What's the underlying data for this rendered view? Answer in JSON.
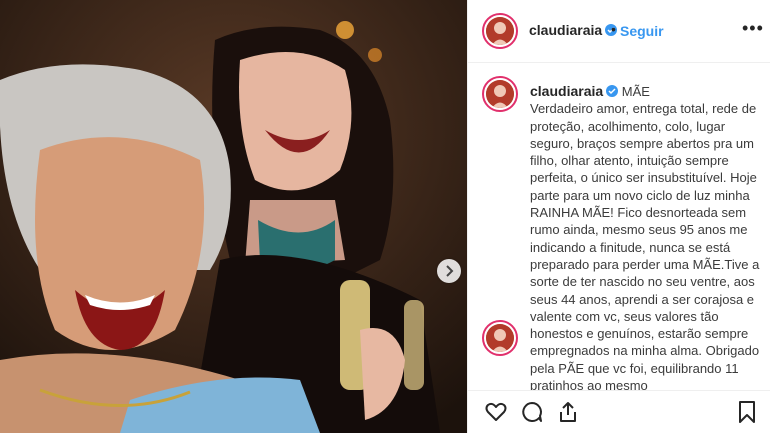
{
  "post": {
    "username": "claudiaraia",
    "follow_label": "Seguir",
    "separator": "•",
    "more_label": "•••",
    "caption_title": "MÃE",
    "caption_body": "Verdadeiro amor, entrega total, rede de proteção, acolhimento, colo, lugar seguro, braços sempre abertos pra um filho, olhar atento, intuição sempre perfeita, o único ser insubstituível. Hoje parte para um novo ciclo de luz minha RAINHA MÃE! Fico desnorteada sem rumo ainda, mesmo seus 95 anos me indicando a finitude, nunca se está preparado para perder uma MÃE.Tive a sorte de ter nascido no seu ventre, aos seus 44 anos, aprendi a ser corajosa e valente com vc, seus valores tão honestos e genuínos, estarão sempre empregnados na minha alma. Obrigado pela PÃE que vc foi, equilibrando 11 pratinhos ao mesmo"
  },
  "colors": {
    "link": "#3897f0",
    "text": "#262626",
    "border": "#efefef",
    "story_ring": "#e1306c"
  },
  "icons": {
    "verified": "verified-badge-icon",
    "next": "chevron-right-icon",
    "like": "heart-icon",
    "comment": "comment-icon",
    "share": "share-icon",
    "save": "bookmark-icon"
  }
}
